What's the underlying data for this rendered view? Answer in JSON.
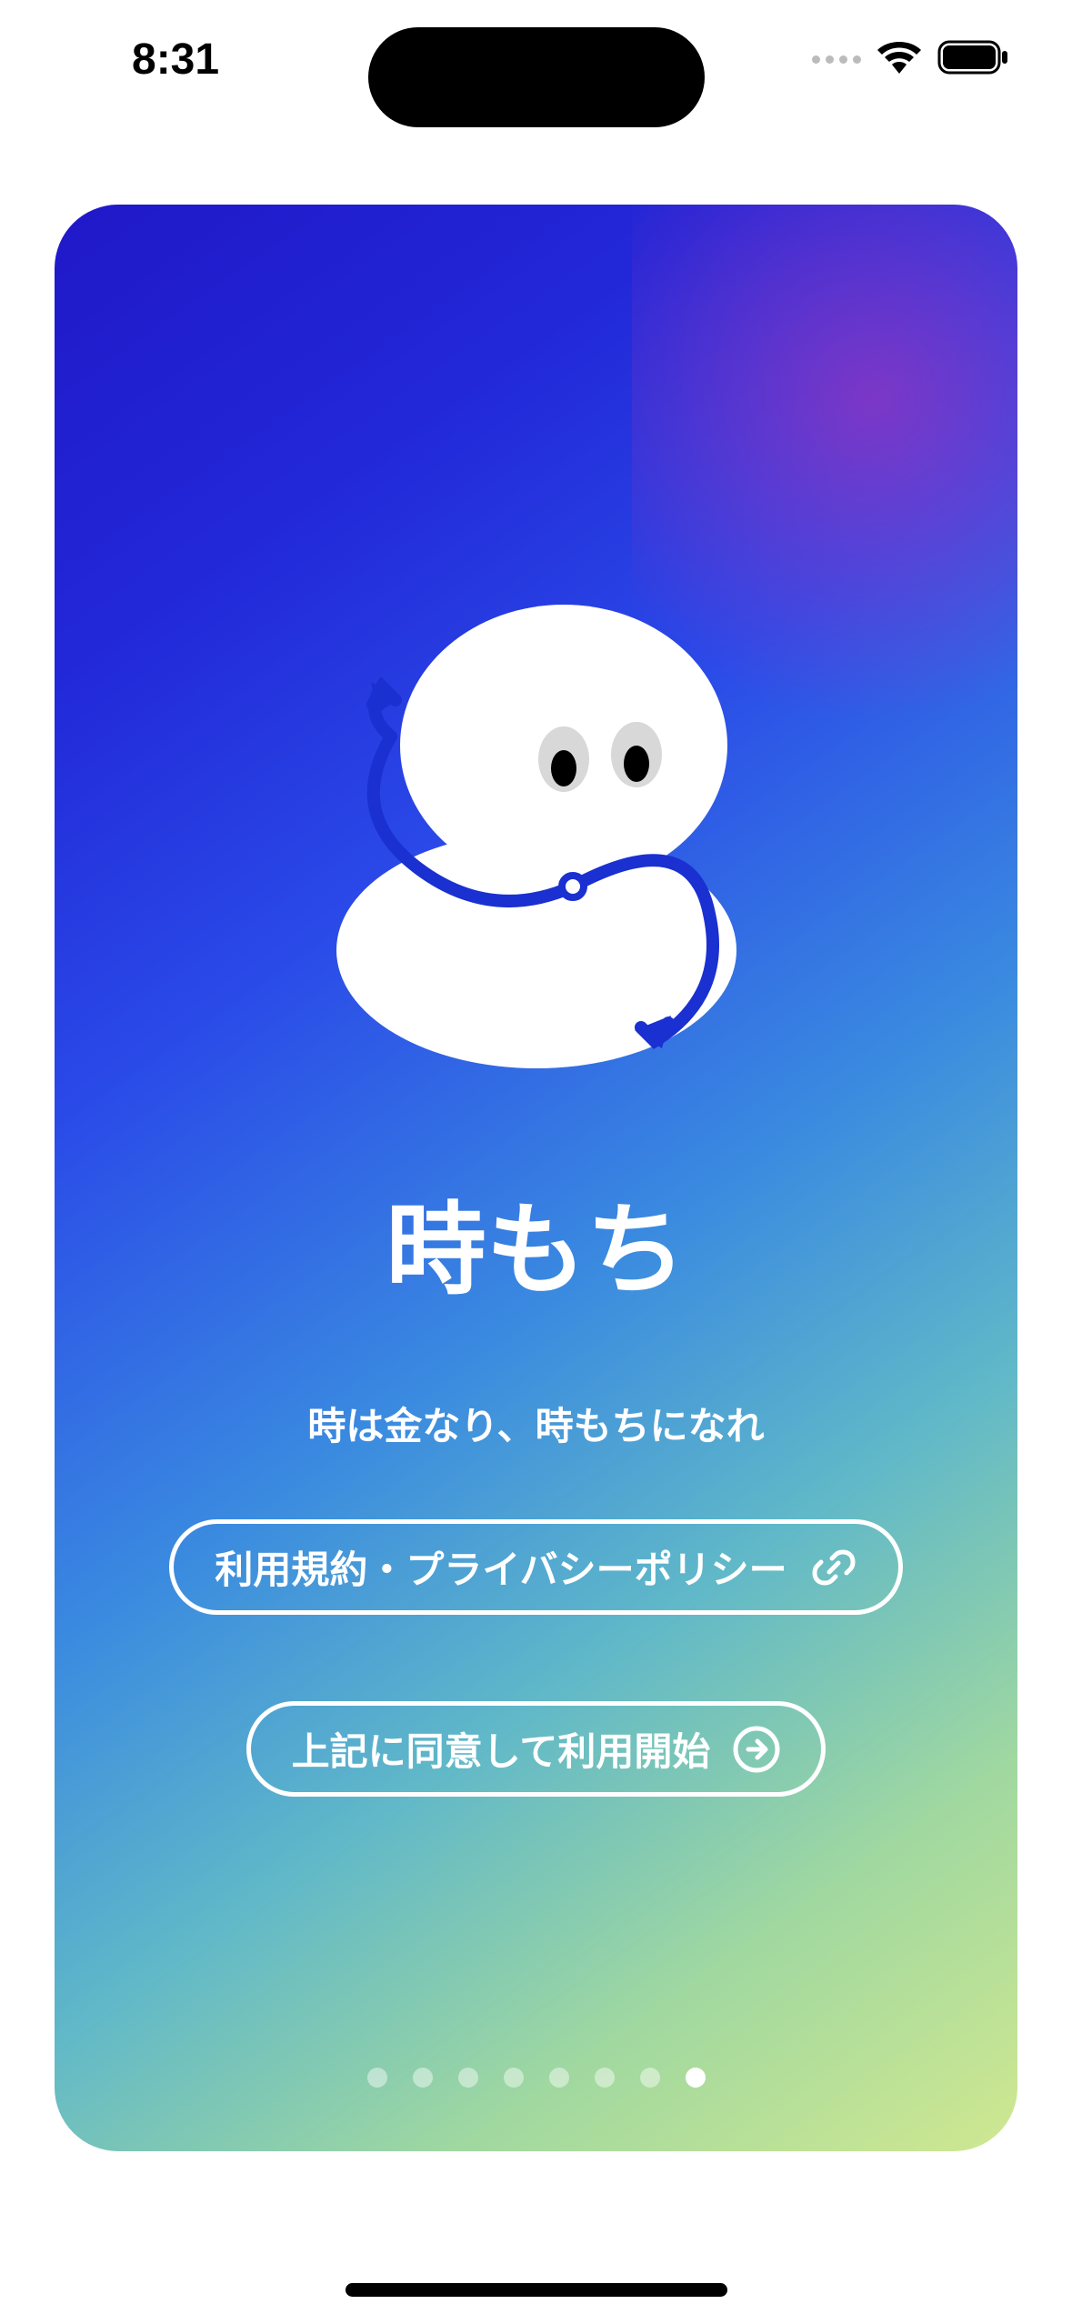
{
  "status_bar": {
    "time": "8:31"
  },
  "onboarding": {
    "title": "時もち",
    "tagline": "時は金なり、時もちになれ",
    "terms_button_label": "利用規約・プライバシーポリシー",
    "agree_button_label": "上記に同意して利用開始",
    "page_count": 8,
    "current_page_index": 7
  }
}
